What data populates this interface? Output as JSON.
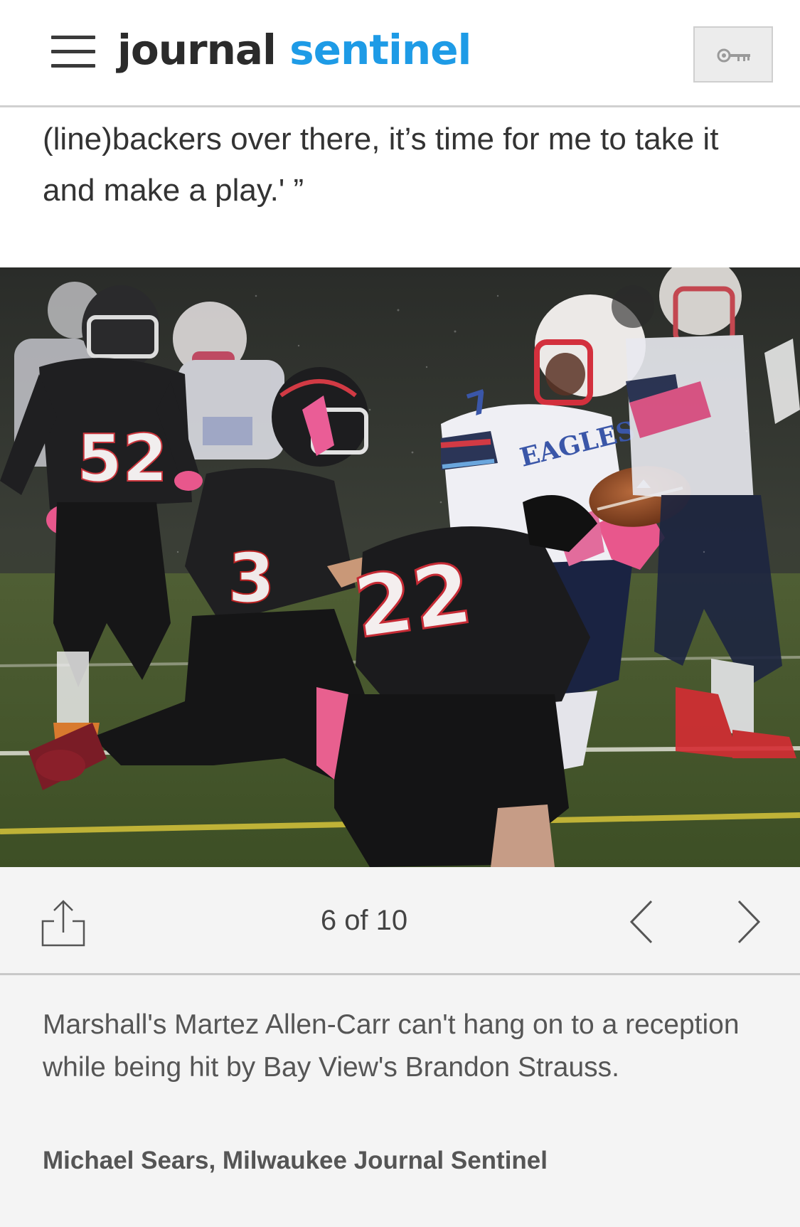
{
  "header": {
    "logo_word1": "journal",
    "logo_word2": "sentinel",
    "menu_icon": "hamburger-menu-icon",
    "account_icon": "key-icon"
  },
  "article": {
    "quote_text": "(line)backers over there, it’s time for me to take it and make a play.' ”"
  },
  "gallery": {
    "photo_alt": "Football players in the rain",
    "current": 6,
    "total": 10,
    "counter_text": "6 of 10",
    "share_icon": "share-icon",
    "prev_icon": "chevron-left-icon",
    "next_icon": "chevron-right-icon",
    "caption": "Marshall's Martez Allen-Carr can't hang on to a reception while being hit by Bay View's Brandon Strauss.",
    "credit": "Michael Sears, Milwaukee Journal Sentinel"
  },
  "photo_marks": {
    "number_a": "52",
    "number_b": "3",
    "number_c": "22",
    "number_d": "7",
    "team_text": "EAGLES"
  },
  "colors": {
    "brand_blue": "#1e9be6",
    "text_dark": "#333333",
    "caption_text": "#555555"
  }
}
